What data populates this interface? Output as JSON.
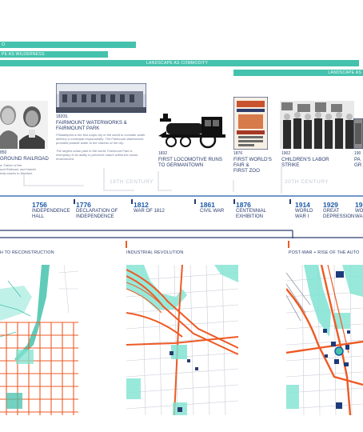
{
  "bands": [
    {
      "label": "O"
    },
    {
      "label": "PE AS WILDERNESS"
    },
    {
      "label": "LANDSCAPE AS COMMODITY"
    },
    {
      "label": "LANDSCAPE AS"
    }
  ],
  "photo_events": [
    {
      "year_title": "850",
      "title": "GROUND RAILROAD",
      "desc": "d, Father of the\nund Railroad, and Harriet\nhelp slaves to freedom."
    },
    {
      "year_title": "1820S",
      "title": "FAIRMOUNT WATERWORKS &\nFAIRMOUNT PARK",
      "desc": "Philadelphia is the first major city in the world to consider water delivery a municipal responsibility. The Fairmount Waterworks provided potable water to the citizens of the city.\n\nThe largest urban park in the world, Fairmount Park is exemplary in its ability to preserve nature within the urban environment."
    },
    {
      "year_title": "1832",
      "title": "FIRST LOCOMOTIVE RUNS\nTO GERMANTOWN",
      "desc": ""
    },
    {
      "year_title": "1876",
      "title": "FIRST WORLD'S\nFAIR &\nFIRST ZOO",
      "desc": ""
    },
    {
      "year_title": "1902",
      "title": "CHILDREN'S LABOR\nSTRIKE",
      "desc": ""
    },
    {
      "year_title": "190",
      "title": "PA\nGR",
      "desc": ""
    }
  ],
  "centuries": {
    "c19": "19TH CENTURY",
    "c20": "20TH CENTURY"
  },
  "timeline": [
    {
      "year": "1756",
      "event": "INDEPENDENCE\nHALL"
    },
    {
      "year": "1776",
      "event": "DECLARATION OF\nINDEPENDENCE"
    },
    {
      "year": "1812",
      "event": "WAR OF 1812"
    },
    {
      "year": "1861",
      "event": "CIVIL WAR"
    },
    {
      "year": "1876",
      "event": "CENTENNIAL\nEXHIBITION"
    },
    {
      "year": "1914",
      "event": "WORLD\nWAR I"
    },
    {
      "year": "1929",
      "event": "GREAT\nDEPRESSION"
    },
    {
      "year": "19",
      "event": "WO\nWA"
    }
  ],
  "maps": [
    {
      "title": "H TO RECONSTRUCTION"
    },
    {
      "title": "INDUSTRIAL REVOLUTION"
    },
    {
      "title": "POST-WAR + RISE OF THE AUTO"
    }
  ],
  "colors": {
    "teal": "#45c2ad",
    "navy": "#2a3c6e",
    "orange": "#ee5a24",
    "blue": "#1d5aa6",
    "aqua": "#7fe3d2"
  }
}
